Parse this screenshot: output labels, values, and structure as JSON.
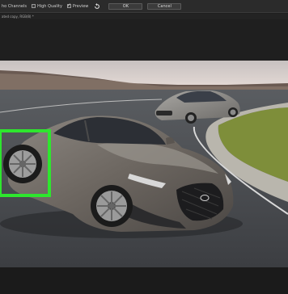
{
  "toolbar": {
    "show_channels_label": "ho Channels",
    "high_quality_label": "High Quality",
    "preview_label": "Preview",
    "ok_label": "OK",
    "cancel_label": "Cancel",
    "reset_icon": "undo-icon"
  },
  "document_tab": {
    "label": "ated copy, RGB/8) *"
  },
  "colors": {
    "highlight": "#2ee62e",
    "background": "#1f1f1f"
  }
}
